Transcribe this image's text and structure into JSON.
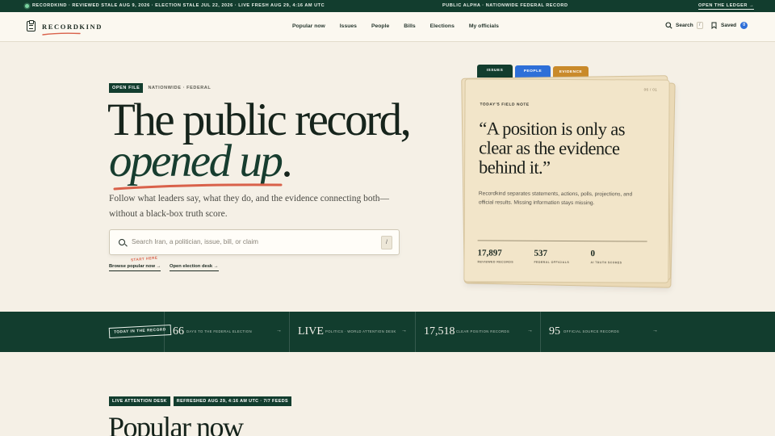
{
  "ticker": {
    "left": "RECORDKIND · REVIEWED STALE AUG 9, 2026 · ELECTION STALE JUL 22, 2026 · LIVE FRESH AUG 29, 4:16 AM UTC",
    "middle": "PUBLIC ALPHA · NATIONWIDE FEDERAL RECORD",
    "right": "OPEN THE LEDGER →"
  },
  "nav": {
    "brand": "RECORDKIND",
    "links": [
      "Popular now",
      "Issues",
      "People",
      "Bills",
      "Elections",
      "My officials"
    ],
    "search_label": "Search",
    "search_key": "/",
    "saved_label": "Saved",
    "saved_count": "0"
  },
  "hero": {
    "tag": "OPEN FILE",
    "tag_sub": "NATIONWIDE · FEDERAL",
    "headline_line1": "The public record,",
    "headline_line2": "opened up",
    "headline_period": ".",
    "lede": "Follow what leaders say, what they do, and the evidence connecting both—without a black-box truth score.",
    "search_placeholder": "Search Iran, a politician, issue, bill, or claim",
    "search_key": "/",
    "start_here": "START HERE",
    "link_popular": "Browse popular now →",
    "link_election": "Open election desk →"
  },
  "card": {
    "tabs": [
      "ISSUES",
      "PEOPLE",
      "EVIDENCE"
    ],
    "page_num": "06 / 01",
    "label": "TODAY'S FIELD NOTE",
    "quote": "“A position is only as clear as the evidence behind it.”",
    "body": "Recordkind separates statements, actions, polls, projections, and official results. Missing information stays missing.",
    "stats": [
      {
        "value": "17,897",
        "label": "REVIEWED RECORDS"
      },
      {
        "value": "537",
        "label": "FEDERAL OFFICIALS"
      },
      {
        "value": "0",
        "label": "AI TRUTH SCORES"
      }
    ]
  },
  "band": {
    "tag": "TODAY IN THE RECORD",
    "cells": [
      {
        "big": "66",
        "small": "DAYS TO THE FEDERAL ELECTION",
        "arrow": "→"
      },
      {
        "big": "LIVE",
        "small": "POLITICS · WORLD ATTENTION DESK",
        "arrow": "→"
      },
      {
        "big": "17,518",
        "small": "CLEAR POSITION RECORDS",
        "arrow": "→"
      },
      {
        "big": "95",
        "small": "OFFICIAL SOURCE RECORDS",
        "arrow": "→"
      }
    ]
  },
  "lower": {
    "tag1": "LIVE ATTENTION DESK",
    "tag2": "REFRESHED AUG 29, 4:16 AM UTC · 7/7 FEEDS",
    "title": "Popular now"
  },
  "colors": {
    "brand_green": "#123d2e",
    "accent_coral": "#d9614a",
    "tab_blue": "#2e6fd8",
    "tab_amber": "#c98a2a",
    "page_bg": "#f5f0e6"
  }
}
